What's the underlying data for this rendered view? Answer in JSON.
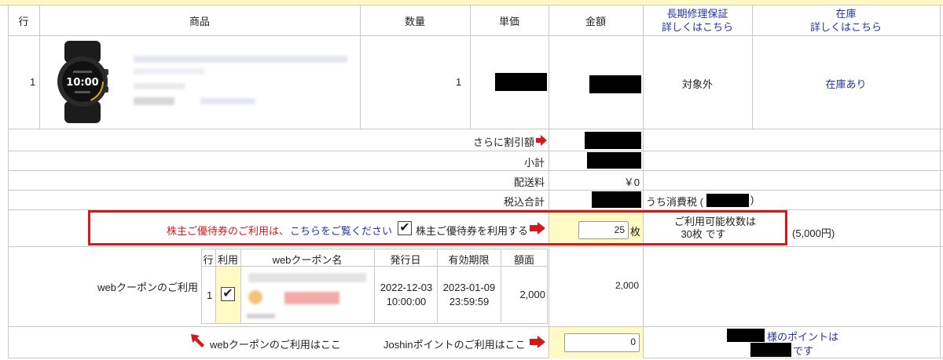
{
  "header": {
    "row": "行",
    "product": "商品",
    "quantity": "数量",
    "unit_price": "単価",
    "amount": "金額",
    "warranty_line1": "長期修理保証",
    "warranty_line2": "詳しくはこちら",
    "stock_line1": "在庫",
    "stock_line2": "詳しくはこちら"
  },
  "item": {
    "row_num": "1",
    "quantity": "1",
    "warranty_status": "対象外",
    "stock_status": "在庫あり",
    "watch_display": "10:00"
  },
  "summary": {
    "extra_discount_label": "さらに割引額",
    "subtotal_label": "小計",
    "shipping_label": "配送料",
    "shipping_value": "￥0",
    "total_label": "税込合計",
    "tax_label_prefix": "うち消費税 (",
    "tax_label_suffix": ")"
  },
  "shareholder": {
    "text_before": "株主ご優待券のご利用は、",
    "link": "こちらをご覧ください",
    "checkbox_label": "株主ご優待券を利用する",
    "checked": true,
    "count_value": "25",
    "count_unit": "枚",
    "available_line1": "ご利用可能枚数は",
    "available_line2": "30枚 です",
    "available_amount": "(5,000円)"
  },
  "coupon": {
    "section_label": "webクーポンのご利用",
    "col_row": "行",
    "col_use": "利用",
    "col_name": "webクーポン名",
    "col_issued": "発行日",
    "col_expiry": "有効期限",
    "col_amount": "額面",
    "row_num": "1",
    "checked": true,
    "issued_date": "2022-12-03",
    "issued_time": "10:00:00",
    "expiry_date": "2023-01-09",
    "expiry_time": "23:59:59",
    "face_value": "2,000",
    "applied_amount": "2,000"
  },
  "footer": {
    "coupon_here": "webクーポンのご利用はここ",
    "points_here": "Joshinポイントのご利用はここ",
    "points_value": "0",
    "points_line1": "様のポイントは",
    "points_line2": "です"
  },
  "colors": {
    "link": "#2233aa",
    "alert_red": "#d21a1a",
    "highlight_yellow": "#fff9c4"
  }
}
